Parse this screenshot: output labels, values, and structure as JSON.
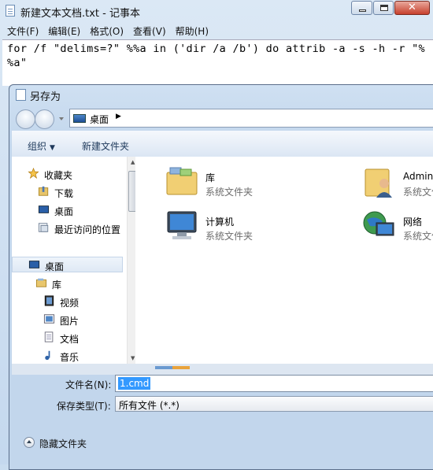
{
  "notepad": {
    "title": "新建文本文档.txt - 记事本",
    "menu": [
      "文件(F)",
      "编辑(E)",
      "格式(O)",
      "查看(V)",
      "帮助(H)"
    ],
    "text_line1": "for /f \"delims=?\" %%a in ('dir /a /b') do attrib -a -s -h -r \"%",
    "text_line2": "%a\""
  },
  "dialog": {
    "title": "另存为",
    "address": "桌面",
    "toolbar": {
      "organize": "组织",
      "new_folder": "新建文件夹"
    },
    "nav": {
      "favorites": "收藏夹",
      "downloads": "下载",
      "desktop_fav": "桌面",
      "recent": "最近访问的位置",
      "desktop": "桌面",
      "library": "库",
      "videos": "视频",
      "pictures": "图片",
      "documents": "文档",
      "music": "音乐"
    },
    "items": [
      {
        "name": "库",
        "type": "系统文件夹",
        "icon": "library-folder-icon"
      },
      {
        "name": "Administ",
        "type": "系统文件夹",
        "icon": "user-folder-icon"
      },
      {
        "name": "计算机",
        "type": "系统文件夹",
        "icon": "computer-icon"
      },
      {
        "name": "网络",
        "type": "系统文件夹",
        "icon": "network-icon"
      }
    ],
    "filename_label": "文件名(N):",
    "filename_value": "1.cmd",
    "filetype_label": "保存类型(T):",
    "filetype_value": "所有文件  (*.*)",
    "hide_folders": "隐藏文件夹"
  },
  "colors": {
    "selection": "#3399ff",
    "title_bar": "#c9dcef"
  }
}
